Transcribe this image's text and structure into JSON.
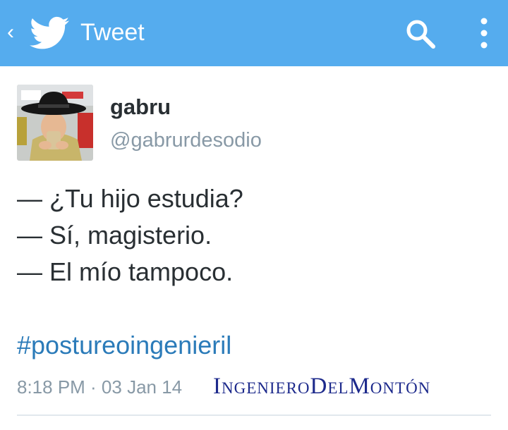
{
  "colors": {
    "header": "#55acee",
    "hashtag": "#2b7bb9",
    "muted": "#8899a6",
    "text": "#292f33",
    "watermark": "#1d2a8c"
  },
  "header": {
    "back_icon": "chevron-left-icon",
    "logo_icon": "twitter-bird-icon",
    "title": "Tweet",
    "search_icon": "search-icon",
    "more_icon": "more-vertical-icon"
  },
  "tweet": {
    "author": {
      "name": "gabru",
      "handle": "@gabrurdesodio"
    },
    "lines": [
      "— ¿Tu hijo estudia?",
      "— Sí, magisterio.",
      "— El mío tampoco."
    ],
    "hashtag": "#postureoingenieril",
    "timestamp": "8:18 PM · 03 Jan 14"
  },
  "watermark": "IngenieroDelMontón"
}
